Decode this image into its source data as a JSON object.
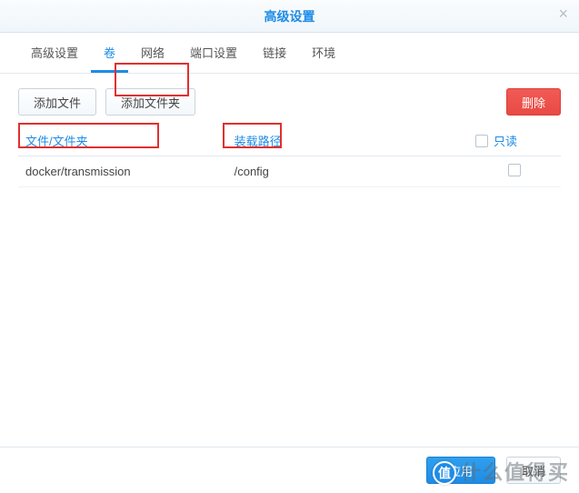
{
  "titlebar": {
    "title": "高级设置"
  },
  "tabs": [
    {
      "label": "高级设置"
    },
    {
      "label": "卷"
    },
    {
      "label": "网络"
    },
    {
      "label": "端口设置"
    },
    {
      "label": "链接"
    },
    {
      "label": "环境"
    }
  ],
  "toolbar": {
    "add_file_label": "添加文件",
    "add_folder_label": "添加文件夹",
    "delete_label": "删除"
  },
  "table": {
    "headers": {
      "path": "文件/文件夹",
      "mount": "装载路径",
      "readonly": "只读"
    },
    "rows": [
      {
        "path": "docker/transmission",
        "mount": "/config",
        "readonly": false
      }
    ]
  },
  "footer": {
    "apply_label": "应用",
    "cancel_label": "取消"
  },
  "watermark": {
    "text": "什么值得买",
    "badge": "值"
  }
}
